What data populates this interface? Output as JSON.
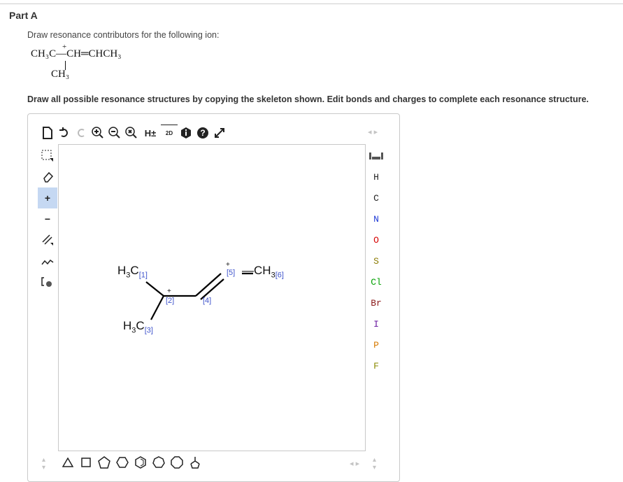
{
  "part": {
    "title": "Part A"
  },
  "question": {
    "prompt": "Draw resonance contributors for the following ion:",
    "formula": {
      "plus": "+",
      "main": "CH₃C—CH═CHCH₃",
      "branch": "CH₃"
    },
    "instruction": "Draw all possible resonance structures by copying the skeleton shown. Edit bonds and charges to complete each resonance structure."
  },
  "toolbar": {
    "h_toggle": "H±",
    "dimension": "2D",
    "nav": "◂ ▸"
  },
  "left_tools": {
    "plus_label": "+",
    "minus_label": "−"
  },
  "elements": [
    {
      "symbol": "H",
      "color": "#222222"
    },
    {
      "symbol": "C",
      "color": "#222222"
    },
    {
      "symbol": "N",
      "color": "#1f3bd6"
    },
    {
      "symbol": "O",
      "color": "#d60000"
    },
    {
      "symbol": "S",
      "color": "#8a7a00"
    },
    {
      "symbol": "Cl",
      "color": "#00a000"
    },
    {
      "symbol": "Br",
      "color": "#8b1a1a"
    },
    {
      "symbol": "I",
      "color": "#6a1aa0"
    },
    {
      "symbol": "P",
      "color": "#d67a00"
    },
    {
      "symbol": "F",
      "color": "#8a8a00"
    }
  ],
  "molecule": {
    "atom1": {
      "label": "H",
      "sub": "3",
      "tail": "C",
      "index": "[1]"
    },
    "atom2": {
      "charge": "+",
      "index": "[2]"
    },
    "atom3": {
      "label": "H",
      "sub": "3",
      "tail": "C",
      "index": "[3]"
    },
    "atom4": {
      "index": "[4]"
    },
    "atom5": {
      "charge": "+",
      "index": "[5]"
    },
    "atom6": {
      "label": "—CH",
      "sub": "3",
      "index": "[6]"
    }
  }
}
